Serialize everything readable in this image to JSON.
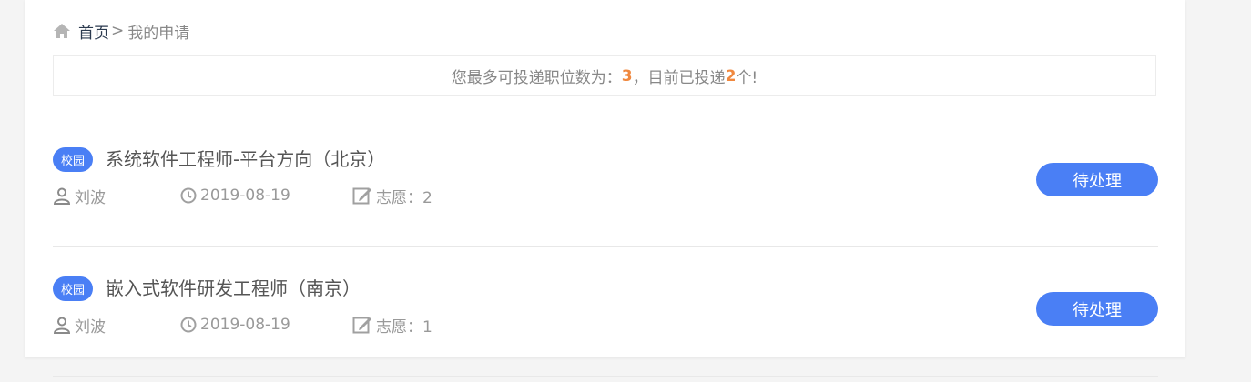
{
  "breadcrumb": {
    "home_label": "首页",
    "separator": ">",
    "current": "我的申请"
  },
  "notice": {
    "prefix": "您最多可投递职位数为：",
    "max_count": "3",
    "middle": "，目前已投递",
    "applied_count": "2",
    "suffix": "个!"
  },
  "applications": [
    {
      "tag": "校园",
      "title": "系统软件工程师-平台方向（北京）",
      "applicant": "刘波",
      "date": "2019-08-19",
      "preference": "志愿：2",
      "status": "待处理"
    },
    {
      "tag": "校园",
      "title": "嵌入式软件研发工程师（南京）",
      "applicant": "刘波",
      "date": "2019-08-19",
      "preference": "志愿：1",
      "status": "待处理"
    }
  ],
  "colors": {
    "accent": "#4a7ff5",
    "highlight": "#f0883e",
    "background": "#f4f4f4"
  }
}
